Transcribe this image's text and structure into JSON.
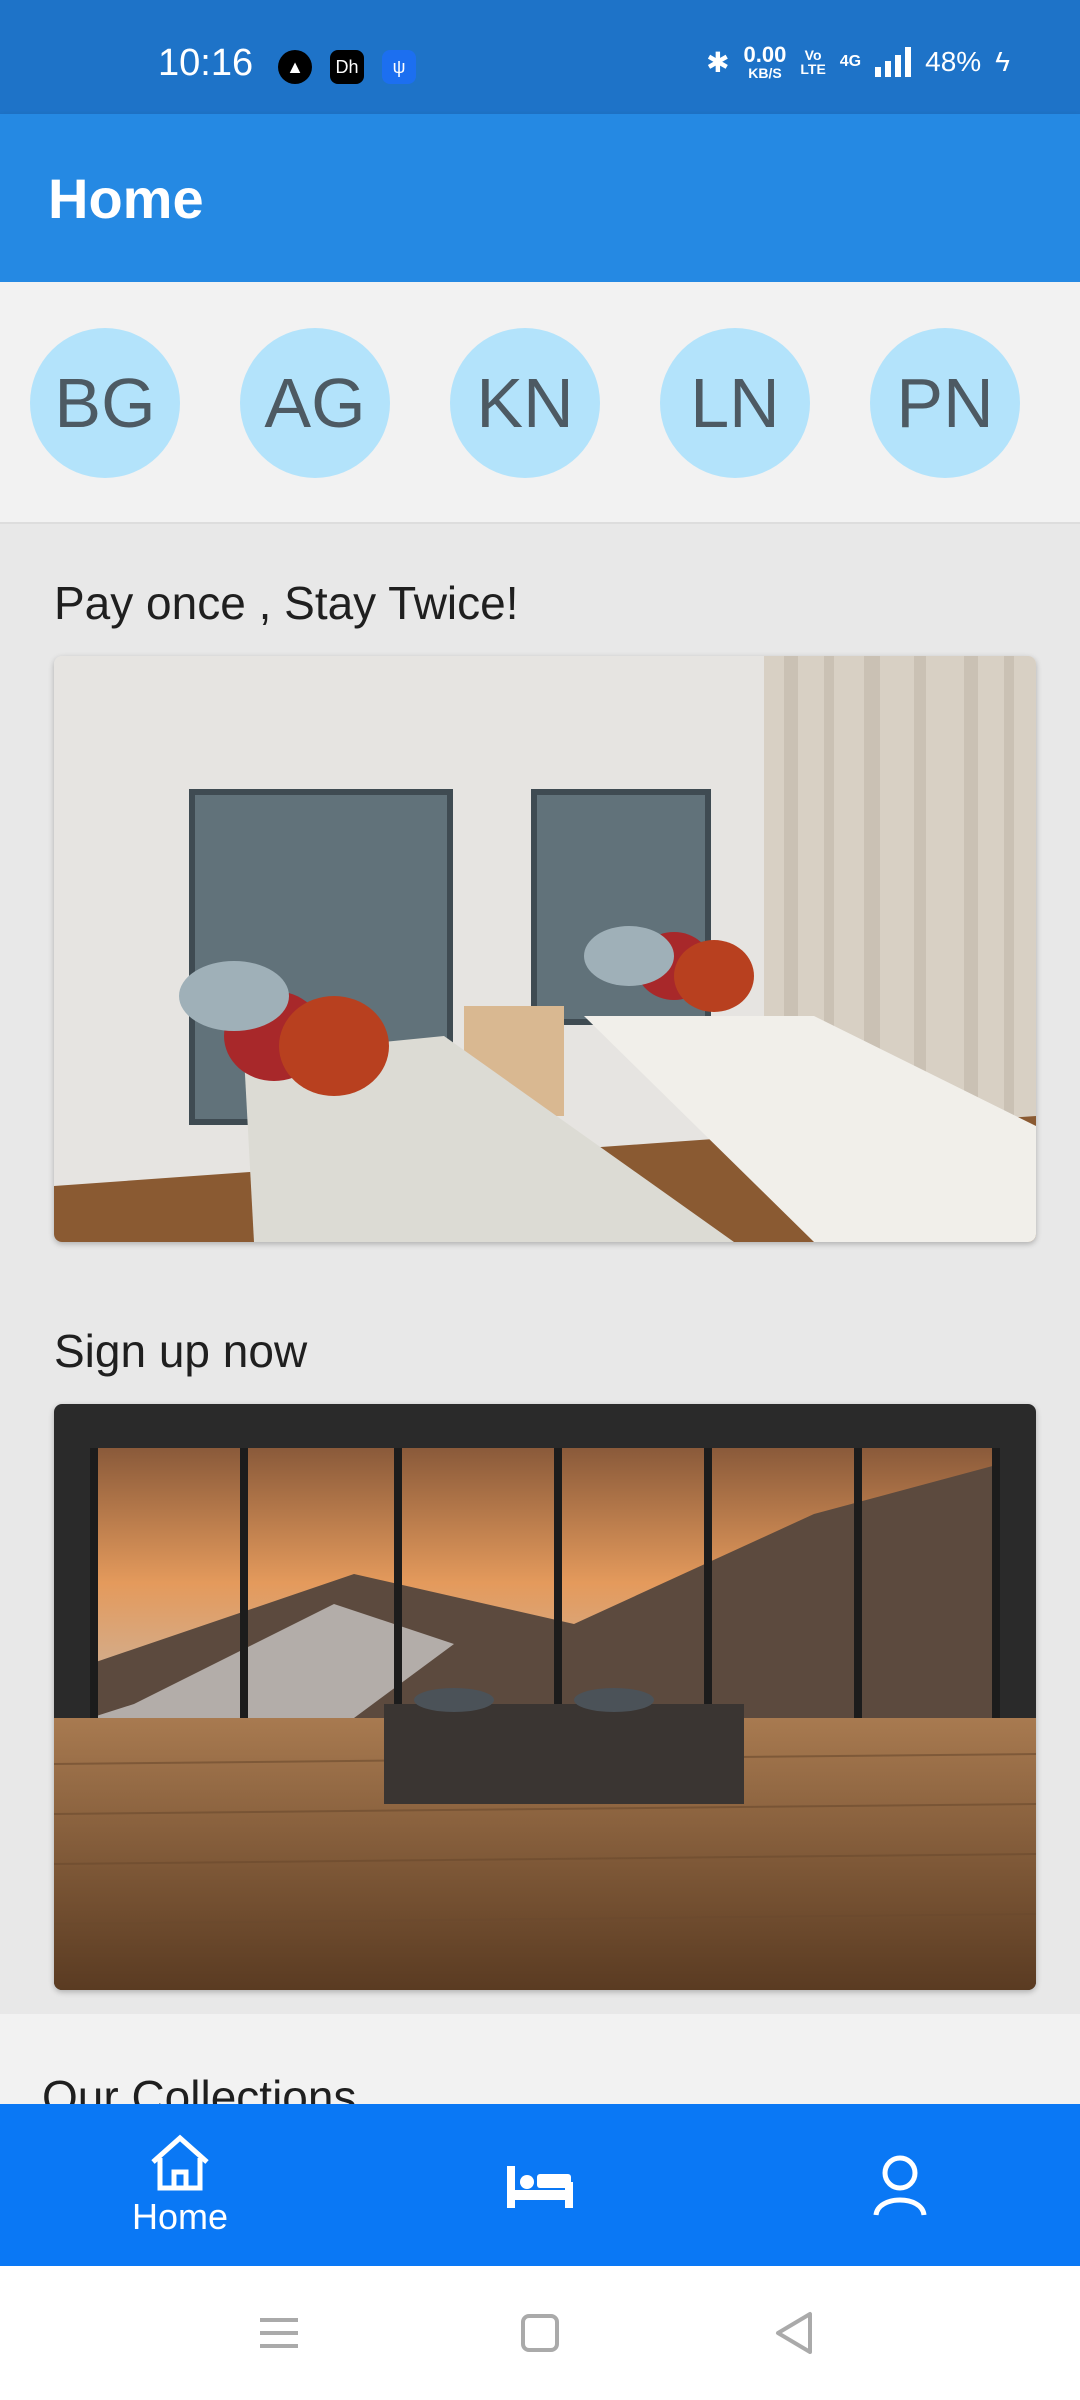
{
  "status_bar": {
    "time": "10:16",
    "app_icons": [
      "app-a-icon",
      "dh-app-icon",
      "usb-icon"
    ],
    "net_speed_value": "0.00",
    "net_speed_unit": "KB/S",
    "volte_top": "Vo",
    "volte_bottom": "LTE",
    "network": "4G",
    "battery": "48%"
  },
  "app_bar": {
    "title": "Home"
  },
  "avatars": [
    "BG",
    "AG",
    "KN",
    "LN",
    "PN"
  ],
  "promos": [
    {
      "title": "Pay once , Stay Twice!"
    },
    {
      "title": "Sign up now"
    }
  ],
  "collections": {
    "title": "Our Collections"
  },
  "bottom_nav": {
    "items": [
      {
        "icon": "home-icon",
        "label": "Home"
      },
      {
        "icon": "bed-icon",
        "label": ""
      },
      {
        "icon": "profile-icon",
        "label": ""
      }
    ]
  },
  "colors": {
    "status_bar": "#1e73c8",
    "app_bar": "#2589e3",
    "avatar_bg": "#b3e3fb",
    "bottom_nav": "#0a78f5"
  }
}
